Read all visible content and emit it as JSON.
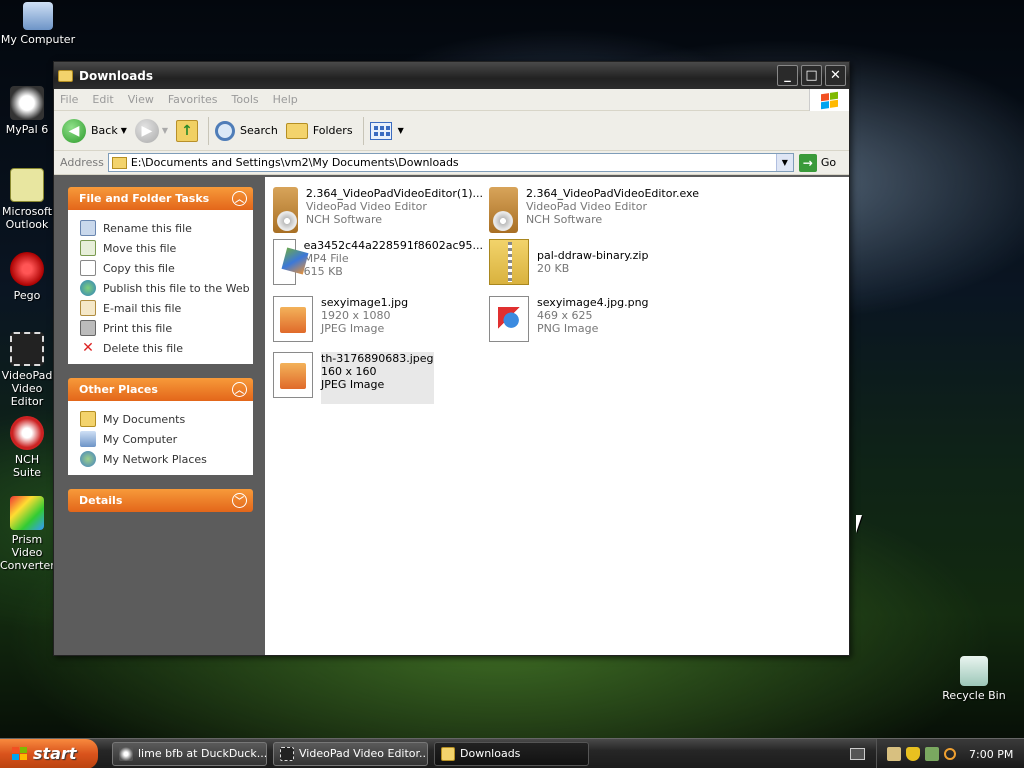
{
  "desktop": {
    "icons": [
      {
        "label": "My Computer"
      },
      {
        "label": "MyPal 6"
      },
      {
        "label": "Microsoft Outlook"
      },
      {
        "label": "Pego"
      },
      {
        "label": "VideoPad Video Editor"
      },
      {
        "label": "NCH Suite"
      },
      {
        "label": "Prism Video Converter"
      },
      {
        "label": "Recycle Bin"
      }
    ]
  },
  "window": {
    "title": "Downloads",
    "controls": {
      "minimize": "_",
      "maximize": "□",
      "close": "✕"
    },
    "menu": [
      "File",
      "Edit",
      "View",
      "Favorites",
      "Tools",
      "Help"
    ],
    "toolbar": {
      "back": "Back",
      "search": "Search",
      "folders": "Folders"
    },
    "address": {
      "label": "Address",
      "value": "E:\\Documents and Settings\\vm2\\My Documents\\Downloads",
      "go": "Go"
    },
    "taskpane": {
      "file_tasks": {
        "title": "File and Folder Tasks",
        "items": [
          "Rename this file",
          "Move this file",
          "Copy this file",
          "Publish this file to the Web",
          "E-mail this file",
          "Print this file",
          "Delete this file"
        ]
      },
      "other_places": {
        "title": "Other Places",
        "items": [
          "My Documents",
          "My Computer",
          "My Network Places"
        ]
      },
      "details": {
        "title": "Details"
      }
    },
    "files": [
      {
        "name": "2.364_VideoPadVideoEditor(1)...",
        "line2": "VideoPad Video Editor",
        "line3": "NCH Software",
        "icon": "installer-icon"
      },
      {
        "name": "2.364_VideoPadVideoEditor.exe",
        "line2": "VideoPad Video Editor",
        "line3": "NCH Software",
        "icon": "installer-icon"
      },
      {
        "name": "ea3452c44a228591f8602ac95...",
        "line2": "MP4 File",
        "line3": "615 KB",
        "icon": "mp4-file-icon"
      },
      {
        "name": "pal-ddraw-binary.zip",
        "line2": "20 KB",
        "line3": "",
        "icon": "zip-file-icon"
      },
      {
        "name": "sexyimage1.jpg",
        "line2": "1920 x 1080",
        "line3": "JPEG Image",
        "icon": "jpeg-image-icon"
      },
      {
        "name": "sexyimage4.jpg.png",
        "line2": "469 x 625",
        "line3": "PNG Image",
        "icon": "png-image-icon"
      },
      {
        "name": "th-3176890683.jpeg",
        "line2": "160 x 160",
        "line3": "JPEG Image",
        "icon": "jpeg-image-icon"
      }
    ]
  },
  "taskbar": {
    "start": "start",
    "tasks": [
      {
        "label": "lime bfb at DuckDuck..."
      },
      {
        "label": "VideoPad Video Editor..."
      },
      {
        "label": "Downloads"
      }
    ],
    "clock": "7:00 PM"
  }
}
